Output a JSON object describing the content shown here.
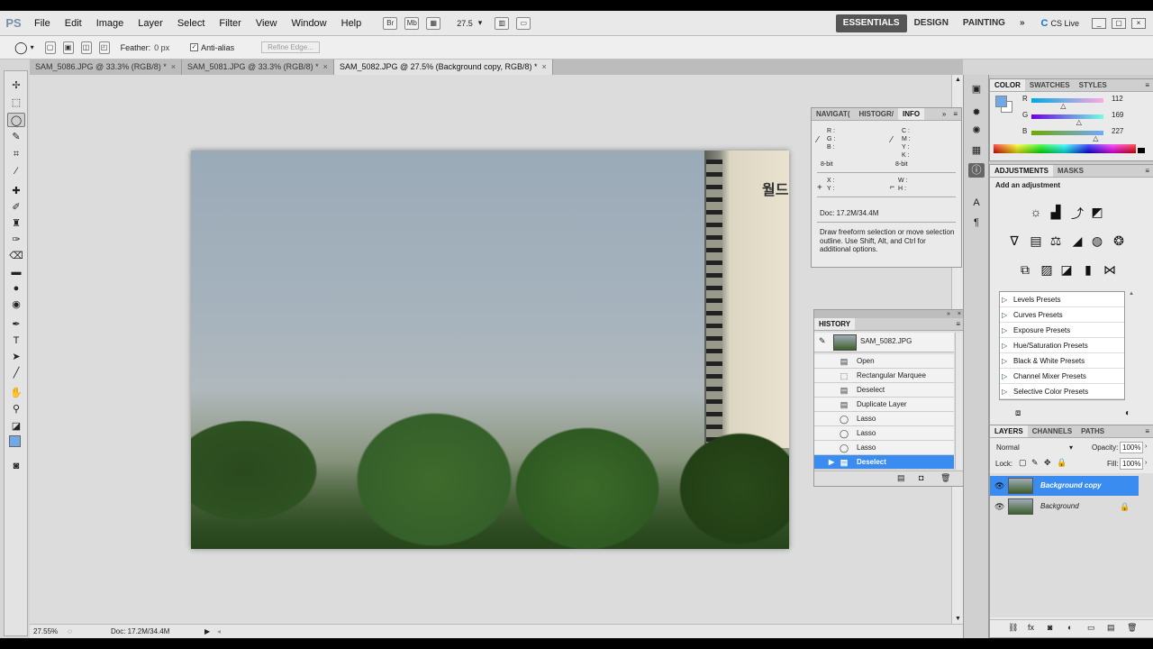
{
  "app": {
    "logo": "PS"
  },
  "menus": [
    "File",
    "Edit",
    "Image",
    "Layer",
    "Select",
    "Filter",
    "View",
    "Window",
    "Help"
  ],
  "app_bar": {
    "zoom": "27.5",
    "zoom_arrow": "▾"
  },
  "workspaces": [
    "ESSENTIALS",
    "DESIGN",
    "PAINTING"
  ],
  "workspace_more": "»",
  "cs_live": "CS Live",
  "options": {
    "feather_label": "Feather:",
    "feather_value": "0 px",
    "antialias_label": "Anti-alias",
    "refine_edge": "Refine Edge..."
  },
  "tabs": [
    {
      "label": "SAM_5086.JPG @ 33.3% (RGB/8) *",
      "close": "×"
    },
    {
      "label": "SAM_5081.JPG @ 33.3% (RGB/8) *",
      "close": "×"
    },
    {
      "label": "SAM_5082.JPG @ 27.5% (Background copy, RGB/8) *",
      "close": "×"
    }
  ],
  "status": {
    "zoom": "27.55%",
    "doc": "Doc: 17.2M/34.4M"
  },
  "info_panel": {
    "tabs": [
      "NAVIGAT(",
      "HISTOGR/",
      "INFO"
    ],
    "rgb_labels": "R :\nG :\nB :",
    "cmyk_labels": "C :\nM :\nY :\nK :",
    "bit_left": "8-bit",
    "bit_right": "8-bit",
    "xy": "X :\nY :",
    "wh": "W :\nH :",
    "doc": "Doc: 17.2M/34.4M",
    "hint": "Draw freeform selection or move selection outline.  Use Shift, Alt, and Ctrl for additional options."
  },
  "history": {
    "title": "HISTORY",
    "snapshot": "SAM_5082.JPG",
    "items": [
      "Open",
      "Rectangular Marquee",
      "Deselect",
      "Duplicate Layer",
      "Lasso",
      "Lasso",
      "Lasso",
      "Deselect"
    ]
  },
  "color_panel": {
    "tabs": [
      "COLOR",
      "SWATCHES",
      "STYLES"
    ],
    "r": {
      "label": "R",
      "value": "112",
      "fraction": 0.44
    },
    "g": {
      "label": "G",
      "value": "169",
      "fraction": 0.66
    },
    "b": {
      "label": "B",
      "value": "227",
      "fraction": 0.89
    },
    "foreground": "#70a9e3"
  },
  "adjustments": {
    "tabs": [
      "ADJUSTMENTS",
      "MASKS"
    ],
    "title": "Add an adjustment",
    "presets": [
      "Levels Presets",
      "Curves Presets",
      "Exposure Presets",
      "Hue/Saturation Presets",
      "Black & White Presets",
      "Channel Mixer Presets",
      "Selective Color Presets"
    ]
  },
  "layers": {
    "tabs": [
      "LAYERS",
      "CHANNELS",
      "PATHS"
    ],
    "blend": "Normal",
    "opacity_label": "Opacity:",
    "opacity": "100%",
    "lock_label": "Lock:",
    "fill_label": "Fill:",
    "fill": "100%",
    "rows": [
      {
        "name": "Background copy"
      },
      {
        "name": "Background"
      }
    ]
  },
  "colors": {
    "accent": "#3b8cf0"
  }
}
